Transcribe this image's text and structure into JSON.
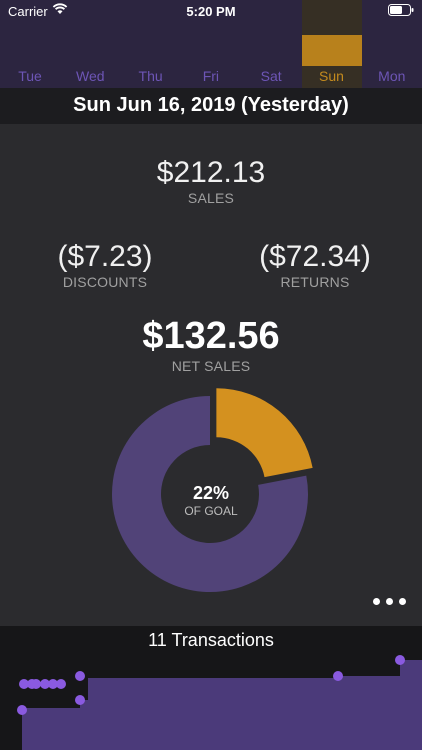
{
  "status_bar": {
    "carrier": "Carrier",
    "time": "5:20 PM"
  },
  "days": [
    {
      "label": "Tue",
      "selected": false
    },
    {
      "label": "Wed",
      "selected": false
    },
    {
      "label": "Thu",
      "selected": false
    },
    {
      "label": "Fri",
      "selected": false
    },
    {
      "label": "Sat",
      "selected": false
    },
    {
      "label": "Sun",
      "selected": true
    },
    {
      "label": "Mon",
      "selected": false
    }
  ],
  "date_header": "Sun Jun 16, 2019 (Yesterday)",
  "metrics": {
    "sales": {
      "value": "$212.13",
      "caption": "SALES"
    },
    "discounts": {
      "value": "($7.23)",
      "caption": "DISCOUNTS"
    },
    "returns": {
      "value": "($72.34)",
      "caption": "RETURNS"
    },
    "net_sales": {
      "value": "$132.56",
      "caption": "NET SALES"
    }
  },
  "goal": {
    "percent_label": "22%",
    "caption": "OF GOAL",
    "fraction": 0.22
  },
  "transactions": {
    "title": "11 Transactions"
  },
  "colors": {
    "purple": "#514378",
    "gold": "#d4911f",
    "dot": "#8a5ae0",
    "area": "#4b3a7a"
  },
  "icons": {
    "wifi": "wifi-icon",
    "battery": "battery-icon",
    "more": "more-horizontal-icon"
  }
}
